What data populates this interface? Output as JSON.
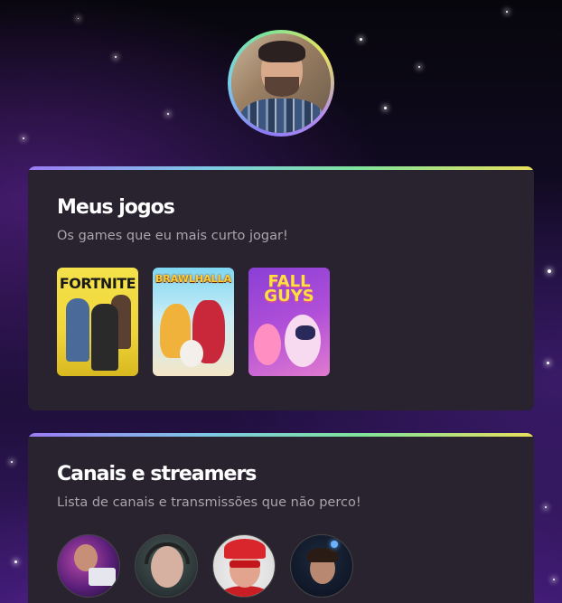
{
  "profile": {
    "avatar_icon": "profile-photo"
  },
  "games_section": {
    "title": "Meus jogos",
    "subtitle": "Os games que eu mais curto jogar!",
    "games": [
      {
        "logo": "FORTNITE"
      },
      {
        "logo": "BRAWLHALLA"
      },
      {
        "logo": "FALL GUYS"
      }
    ]
  },
  "streamers_section": {
    "title": "Canais e streamers",
    "subtitle": "Lista de canais e transmissões que não perco!"
  },
  "colors": {
    "card_background": "#28232f",
    "accent_gradient": [
      "#9a7cf5",
      "#7ec8e6",
      "#7fe39d",
      "#e8df5c"
    ],
    "title": "#ffffff",
    "subtitle": "#a8a5ae"
  }
}
